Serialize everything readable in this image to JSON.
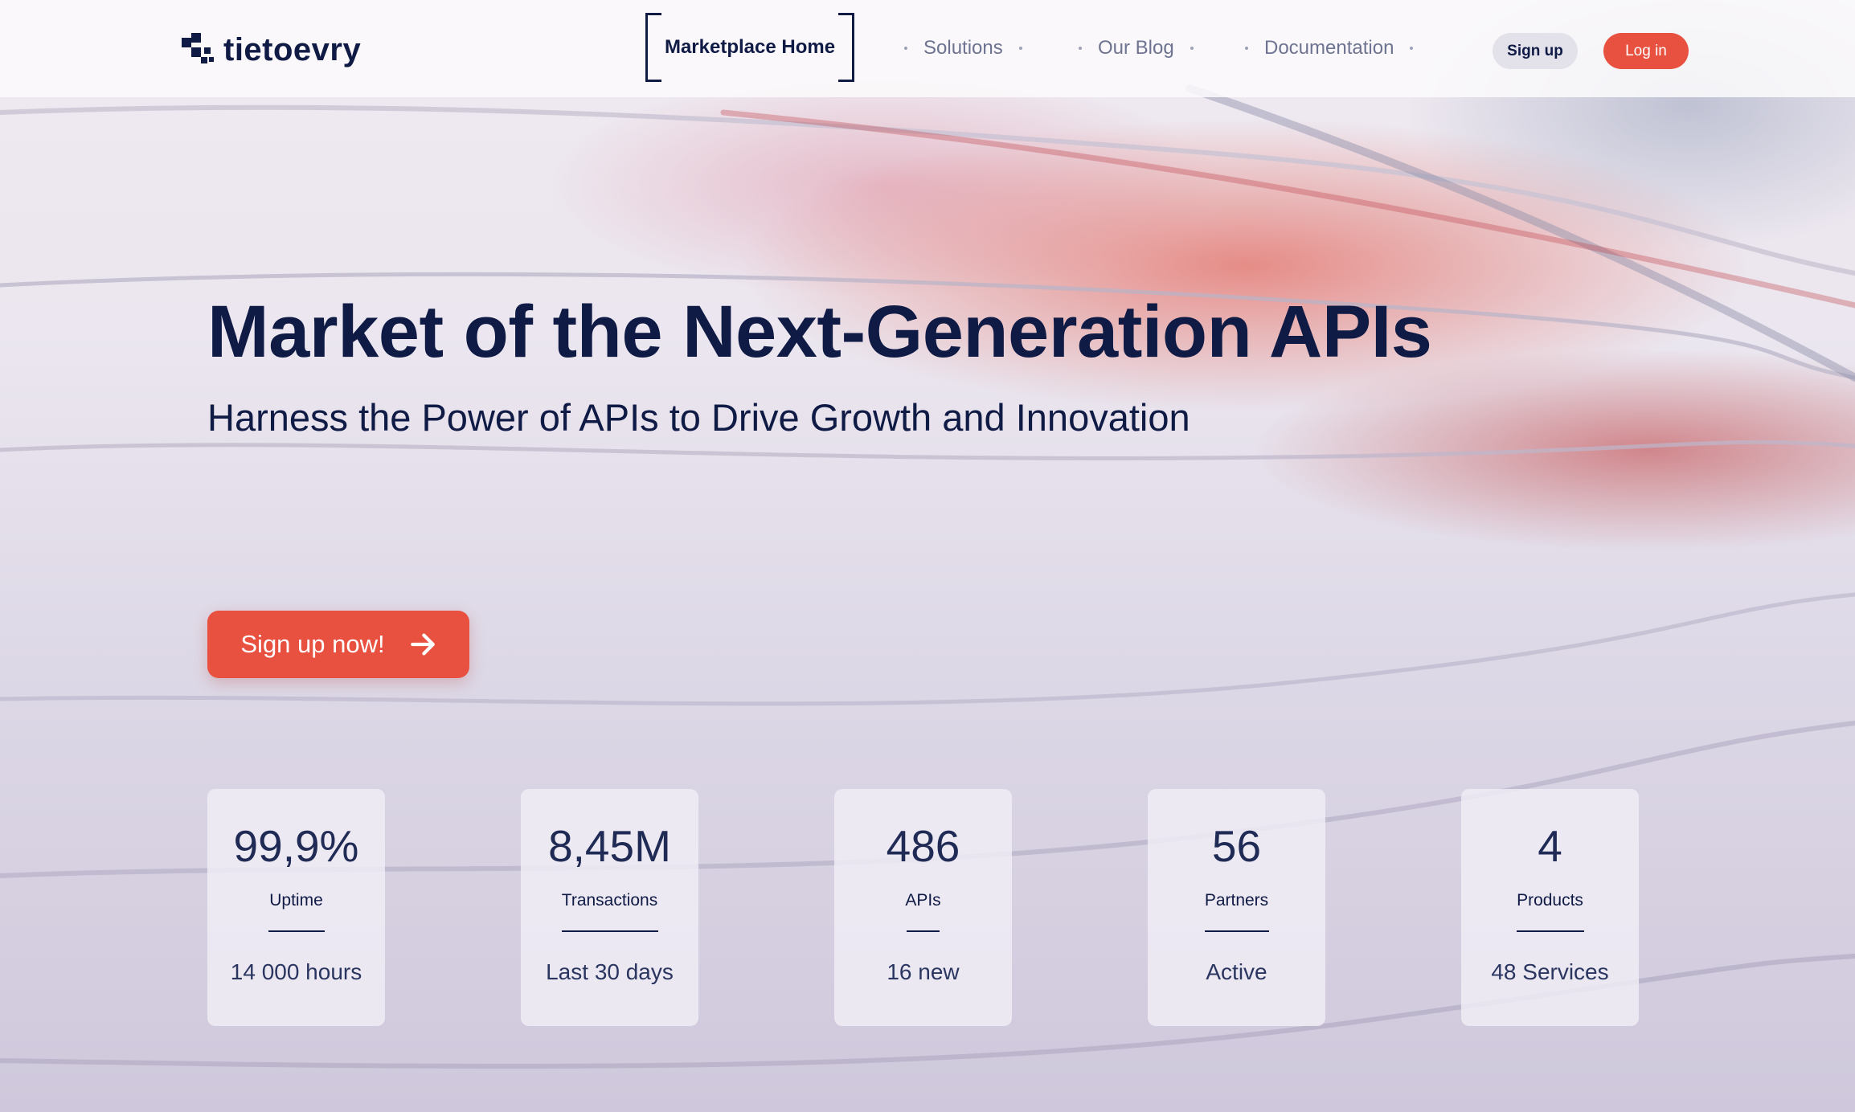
{
  "header": {
    "logo_text": "tietoevry",
    "nav": {
      "active": "Marketplace Home",
      "items": [
        "Solutions",
        "Our Blog",
        "Documentation"
      ]
    },
    "signup_label": "Sign up",
    "login_label": "Log in"
  },
  "hero": {
    "title": "Market of the Next-Generation APIs",
    "subtitle": "Harness the Power of APIs to Drive Growth and Innovation",
    "cta_label": "Sign up now!"
  },
  "stats": [
    {
      "value": "99,9%",
      "label": "Uptime",
      "detail": "14 000 hours"
    },
    {
      "value": "8,45M",
      "label": "Transactions",
      "detail": "Last 30 days"
    },
    {
      "value": "486",
      "label": "APIs",
      "detail": "16 new"
    },
    {
      "value": "56",
      "label": "Partners",
      "detail": "Active"
    },
    {
      "value": "4",
      "label": "Products",
      "detail": "48 Services"
    }
  ],
  "colors": {
    "brand_navy": "#0f1a45",
    "accent_red": "#e8503f",
    "nav_muted": "#6d7390"
  }
}
